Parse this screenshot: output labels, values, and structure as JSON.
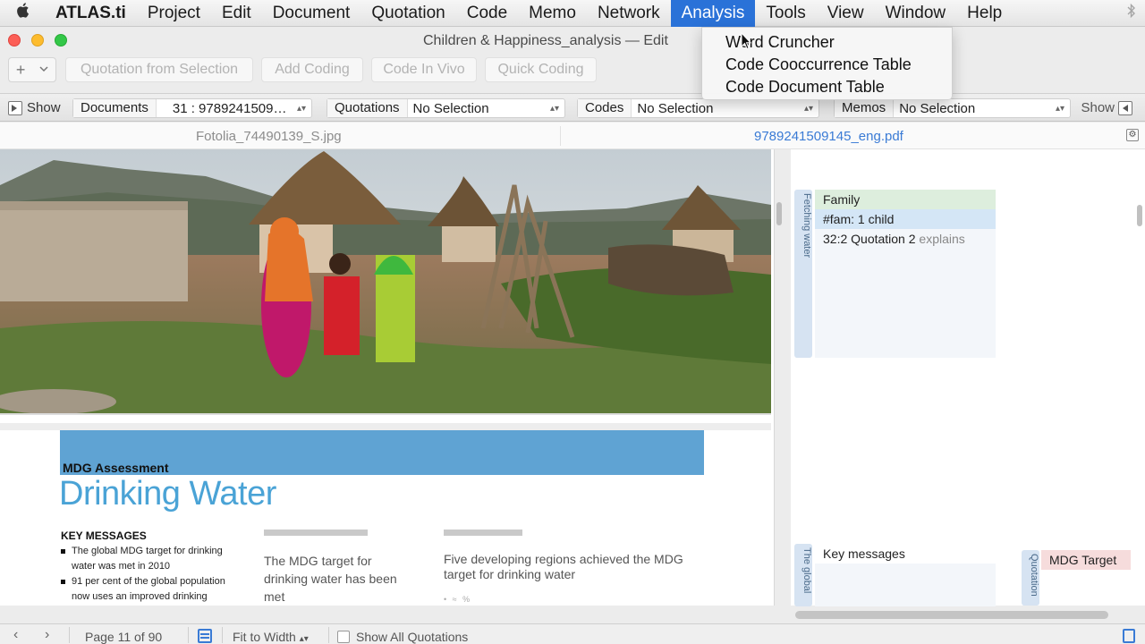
{
  "menubar": {
    "app_name": "ATLAS.ti",
    "items": [
      "Project",
      "Edit",
      "Document",
      "Quotation",
      "Code",
      "Memo",
      "Network",
      "Analysis",
      "Tools",
      "View",
      "Window",
      "Help"
    ],
    "active_item": "Analysis",
    "icons": [
      "apple-icon",
      "bluetooth-icon"
    ]
  },
  "window": {
    "title": "Children & Happiness_analysis — Edit"
  },
  "toolbar": {
    "add_symbol": "+",
    "buttons": [
      "Quotation from Selection",
      "Add Coding",
      "Code In Vivo",
      "Quick Coding"
    ]
  },
  "filterbar": {
    "show_left": "Show",
    "show_right": "Show",
    "documents_label": "Documents",
    "documents_value": "31 : 9789241509…",
    "quotations_label": "Quotations",
    "quotations_value": "No Selection",
    "codes_label": "Codes",
    "codes_value": "No Selection",
    "memos_label": "Memos",
    "memos_value": "No Selection"
  },
  "tabs": {
    "left": "Fotolia_74490139_S.jpg",
    "right": "9789241509145_eng.pdf"
  },
  "document": {
    "section_label": "MDG Assessment",
    "title": "Drinking Water",
    "key_messages_heading": "KEY MESSAGES",
    "key_messages": [
      "The global MDG target for drinking water was met in 2010",
      "91 per cent of the global population now uses an improved drinking"
    ],
    "column2_text": "The MDG target for drinking water has been met",
    "column3_text": "Five developing regions achieved the MDG target for drinking water",
    "column3_partial": "• ≈ %"
  },
  "margin": {
    "bar1_label": "Fetching water",
    "family_code": "Family",
    "fam_code": "#fam: 1 child",
    "link_quote": "32:2 Quotation 2",
    "link_relation": "explains",
    "bar2_label": "The global",
    "key_messages_code": "Key messages",
    "bar3_label": "Quotation",
    "mdg_target_code": "MDG Target"
  },
  "statusbar": {
    "page": "Page 11 of 90",
    "zoom": "Fit to Width",
    "show_all": "Show All Quotations"
  },
  "analysis_menu": {
    "items": [
      "Word Cruncher",
      "Code Cooccurrence Table",
      "Code Document Table"
    ]
  },
  "colors": {
    "menu_highlight": "#2a72d8",
    "doc_band": "#5fa3d3",
    "doc_title": "#4aa3d6",
    "code_family": "#ddeedd",
    "code_fam": "#d4e6f6",
    "code_mdg": "#f6dcdc"
  }
}
